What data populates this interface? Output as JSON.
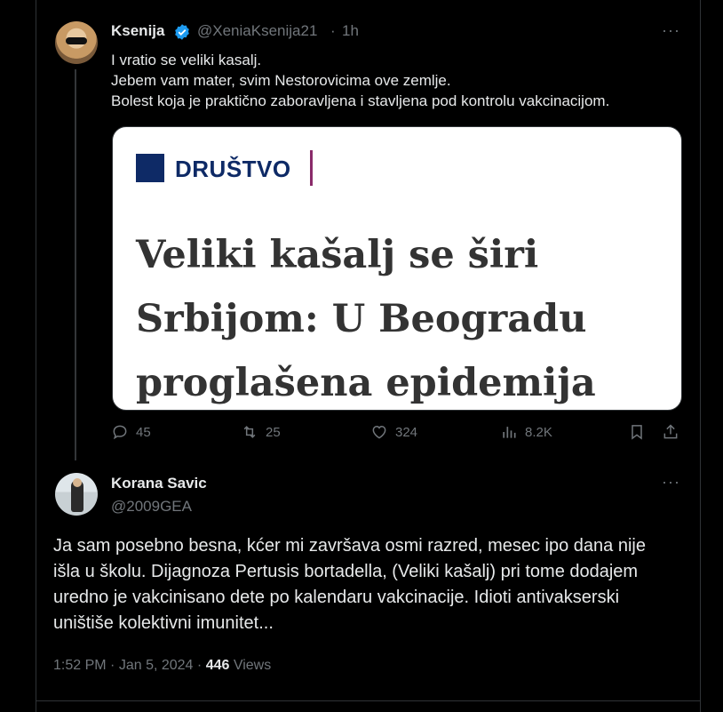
{
  "tweet": {
    "author_name": "Ksenija",
    "author_handle": "@XeniaKsenija21",
    "separator": "·",
    "time_ago": "1h",
    "more": "···",
    "text_lines": [
      "I vratio se veliki kasalj.",
      "Jebem vam mater, svim Nestorovicima ove zemlje.",
      "Bolest koja je praktično zaboravljena i stavljena pod kontrolu vakcinacijom."
    ],
    "card": {
      "section": "DRUŠTVO",
      "headline": "Veliki kašalj se širi Srbijom: U Beogradu proglašena epidemija"
    },
    "actions": {
      "replies": "45",
      "retweets": "25",
      "likes": "324",
      "views": "8.2K"
    }
  },
  "reply": {
    "author_name": "Korana Savic",
    "author_handle": "@2009GEA",
    "more": "···",
    "text": "Ja sam posebno besna, kćer mi završava osmi razred, mesec ipo dana nije išla u školu. Dijagnoza Pertusis bortadella, (Veliki kašalj) pri tome dodajem uredno je vakcinisano dete po kalendaru vakcinacije. Idioti antivakserski uništiše  kolektivni imunitet...",
    "time": "1:52 PM",
    "date": "Jan 5, 2024",
    "view_count": "446",
    "views_label": "Views",
    "separator": "·"
  },
  "colors": {
    "background": "#000000",
    "text": "#e7e9ea",
    "muted": "#71767b",
    "verified": "#1d9bf0",
    "card_brand": "#0e2a66"
  }
}
